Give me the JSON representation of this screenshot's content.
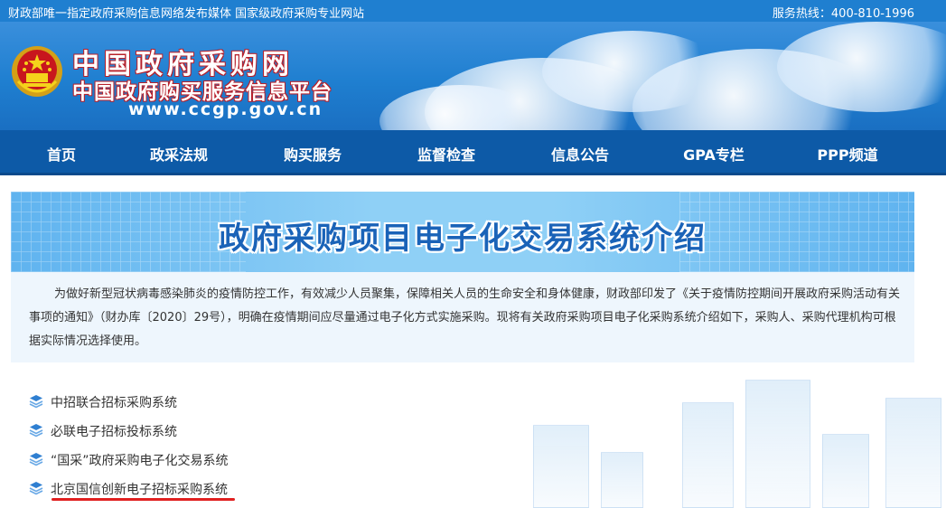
{
  "topbar": {
    "left_text": "财政部唯一指定政府采购信息网络发布媒体 国家级政府采购专业网站",
    "right_text": "服务热线：400-810-1996"
  },
  "header": {
    "title_line1": "中国政府采购网",
    "title_line2": "中国政府购买服务信息平台",
    "url": "www.ccgp.gov.cn",
    "emblem_icon": "national-emblem-icon"
  },
  "nav": {
    "items": [
      {
        "label": "首页"
      },
      {
        "label": "政采法规"
      },
      {
        "label": "购买服务"
      },
      {
        "label": "监督检查"
      },
      {
        "label": "信息公告"
      },
      {
        "label": "GPA专栏"
      },
      {
        "label": "PPP频道"
      }
    ]
  },
  "banner": {
    "title": "政府采购项目电子化交易系统介绍"
  },
  "intro": {
    "text": "为做好新型冠状病毒感染肺炎的疫情防控工作，有效减少人员聚集，保障相关人员的生命安全和身体健康，财政部印发了《关于疫情防控期间开展政府采购活动有关事项的通知》（财办库〔2020〕29号），明确在疫情期间应尽量通过电子化方式实施采购。现将有关政府采购项目电子化采购系统介绍如下，采购人、采购代理机构可根据实际情况选择使用。"
  },
  "systems": {
    "icon": "stack-layers-icon",
    "items": [
      {
        "label": "中招联合招标采购系统"
      },
      {
        "label": "必联电子招标投标系统"
      },
      {
        "label": "“国采”政府采购电子化交易系统"
      },
      {
        "label": "北京国信创新电子招标采购系统"
      }
    ]
  },
  "colors": {
    "brand_blue": "#1f7fd0",
    "nav_blue": "#0d5aa7",
    "banner_title": "#1a63b8",
    "highlight_underline": "#e02020"
  }
}
